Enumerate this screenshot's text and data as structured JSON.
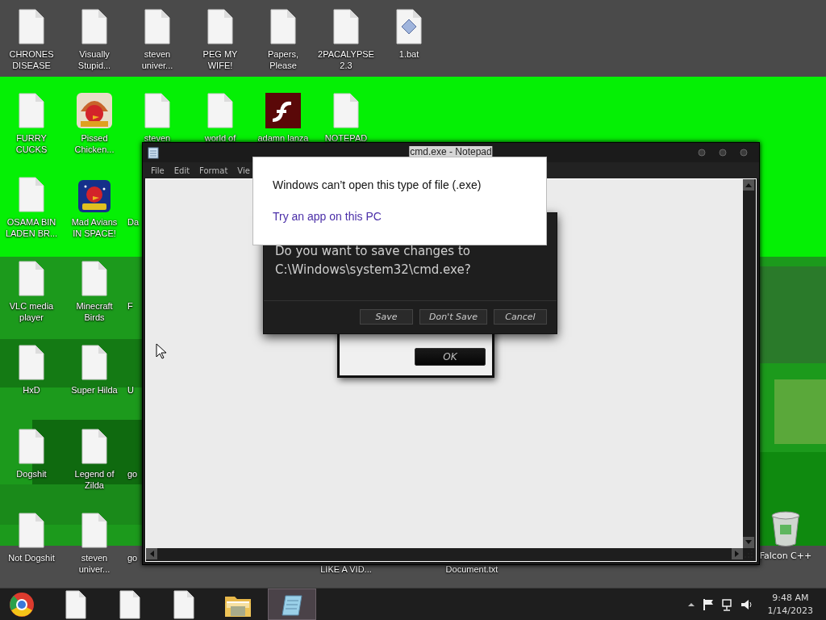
{
  "desktop": {
    "columns": [
      {
        "icons": [
          {
            "label": "CHRONES DISEASE",
            "kind": "file"
          },
          {
            "label": "FURRY CUCKS",
            "kind": "file"
          },
          {
            "label": "OSAMA BIN LADEN BR...",
            "kind": "file"
          },
          {
            "label": "VLC media player",
            "kind": "file"
          },
          {
            "label": "HxD",
            "kind": "file"
          },
          {
            "label": "Dogshit",
            "kind": "file"
          },
          {
            "label": "Not Dogshit",
            "kind": "file"
          }
        ]
      },
      {
        "icons": [
          {
            "label": "Visually Stupid...",
            "kind": "file"
          },
          {
            "label": "Pissed Chicken...",
            "kind": "seasons"
          },
          {
            "label": "Mad Avians IN SPACE!",
            "kind": "space"
          },
          {
            "label": "Minecraft Birds",
            "kind": "file"
          },
          {
            "label": "Super Hilda",
            "kind": "file"
          },
          {
            "label": "Legend of Zilda",
            "kind": "file"
          },
          {
            "label": "steven univer...",
            "kind": "file"
          }
        ]
      },
      {
        "icons": [
          {
            "label": "steven univer...",
            "kind": "file"
          },
          {
            "label": "steven",
            "kind": "file"
          },
          {
            "label": "Da",
            "kind": "clipped"
          },
          {
            "label": "F",
            "kind": "clipped"
          },
          {
            "label": "U",
            "kind": "clipped"
          },
          {
            "label": "go",
            "kind": "clipped"
          },
          {
            "label": "go",
            "kind": "clipped"
          }
        ]
      },
      {
        "icons": [
          {
            "label": "PEG MY WIFE!",
            "kind": "file"
          },
          {
            "label": "world of",
            "kind": "file"
          }
        ]
      },
      {
        "icons": [
          {
            "label": "Papers, Please",
            "kind": "file"
          },
          {
            "label": "adamn lanza",
            "kind": "flash"
          }
        ]
      },
      {
        "icons": [
          {
            "label": "2PACALYPSE 2.3",
            "kind": "file"
          },
          {
            "label": "NOTEPAD",
            "kind": "file"
          },
          {
            "kind": "empty"
          },
          {
            "kind": "empty"
          },
          {
            "kind": "empty"
          },
          {
            "kind": "empty"
          },
          {
            "label": "LIKE A VID...",
            "kind": "tail"
          }
        ]
      },
      {
        "icons": [
          {
            "label": "1.bat",
            "kind": "bat"
          }
        ]
      },
      {
        "icons": [
          {
            "kind": "empty"
          },
          {
            "kind": "empty"
          },
          {
            "kind": "empty"
          },
          {
            "kind": "empty"
          },
          {
            "kind": "empty"
          },
          {
            "kind": "empty"
          },
          {
            "label": "Document.txt",
            "kind": "tail"
          }
        ]
      }
    ],
    "recycle_bin": {
      "label": "Falcon C++"
    }
  },
  "notepad": {
    "title": "cmd.exe - Notepad",
    "menu": [
      "File",
      "Edit",
      "Format",
      "Vie"
    ]
  },
  "ok_dialog": {
    "button": "OK"
  },
  "save_dialog": {
    "message": "Do you want to save changes to C:\\Windows\\system32\\cmd.exe?",
    "buttons": [
      "Save",
      "Don't Save",
      "Cancel"
    ]
  },
  "open_popup": {
    "message": "Windows can’t open this type of file (.exe)",
    "link": "Try an app on this PC"
  },
  "taskbar": {
    "apps": [
      {
        "kind": "browser",
        "selected": false
      },
      {
        "kind": "file",
        "selected": false
      },
      {
        "kind": "file",
        "selected": false
      },
      {
        "kind": "file",
        "selected": false
      },
      {
        "kind": "folder",
        "selected": false
      },
      {
        "kind": "notepad",
        "selected": true
      }
    ],
    "clock": {
      "time": "9:48 AM",
      "date": "1/14/2023"
    }
  }
}
